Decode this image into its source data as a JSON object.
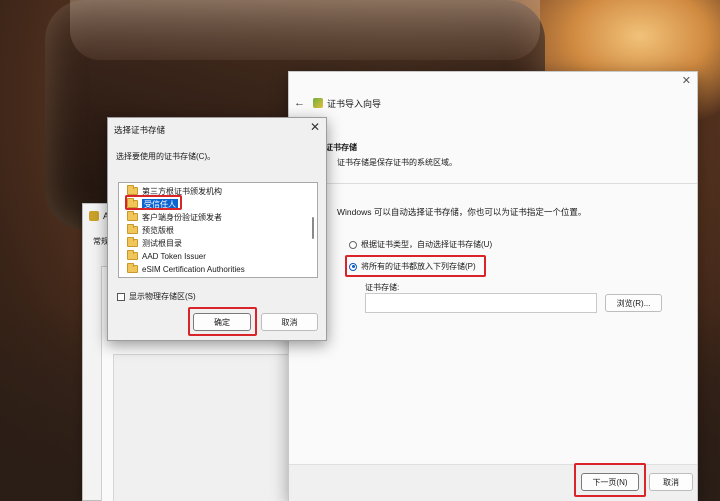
{
  "background_window": {
    "title_prefix": "A",
    "tab_label": "常规"
  },
  "wizard": {
    "close_symbol": "✕",
    "back_symbol": "←",
    "title": "证书导入向导",
    "section_title": "证书存储",
    "section_desc": "证书存储是保存证书的系统区域。",
    "intro": "Windows 可以自动选择证书存储，你也可以为证书指定一个位置。",
    "radio_auto": "根据证书类型，自动选择证书存储(U)",
    "radio_manual": "将所有的证书都放入下列存储(P)",
    "store_label": "证书存储:",
    "store_value": "",
    "browse_button": "浏览(R)...",
    "next_button": "下一页(N)",
    "cancel_button": "取消"
  },
  "dialog": {
    "title": "选择证书存储",
    "close_symbol": "✕",
    "prompt": "选择要使用的证书存储(C)。",
    "tree_items": [
      "第三方根证书颁发机构",
      "受信任人",
      "客户端身份验证颁发者",
      "预览版根",
      "测试根目录",
      "AAD Token Issuer",
      "eSIM Certification Authorities"
    ],
    "selected_index": 1,
    "show_physical": "显示物理存储区(S)",
    "ok_button": "确定",
    "cancel_button": "取消"
  },
  "colors": {
    "highlight": "#d9252a",
    "selection": "#0a64d2"
  }
}
